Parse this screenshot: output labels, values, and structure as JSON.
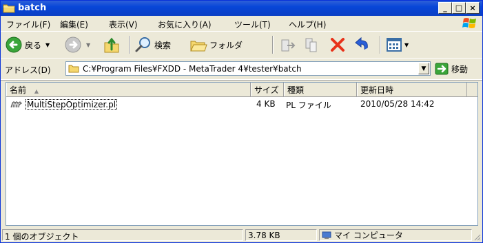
{
  "window": {
    "title": "batch",
    "min_label": "_",
    "max_label": "□",
    "close_label": "×"
  },
  "menu": {
    "items": [
      "ファイル(F)",
      "編集(E)",
      "表示(V)",
      "お気に入り(A)",
      "ツール(T)",
      "ヘルプ(H)"
    ]
  },
  "toolbar": {
    "back_label": "戻る",
    "search_label": "検索",
    "folders_label": "フォルダ"
  },
  "address": {
    "label": "アドレス(D)",
    "path": "C:¥Program Files¥FXDD - MetaTrader 4¥tester¥batch",
    "go_label": "移動"
  },
  "list": {
    "columns": [
      "名前",
      "サイズ",
      "種類",
      "更新日時"
    ],
    "rows": [
      {
        "name": "MultiStepOptimizer.pl",
        "size": "4 KB",
        "type": "PL ファイル",
        "modified": "2010/05/28 14:42"
      }
    ]
  },
  "status": {
    "objects": "1 個のオブジェクト",
    "size": "3.78 KB",
    "zone": "マイ コンピュータ"
  },
  "colors": {
    "titlebar": "#0846d8",
    "chrome": "#ece9d8",
    "close_red": "#e8321a"
  }
}
